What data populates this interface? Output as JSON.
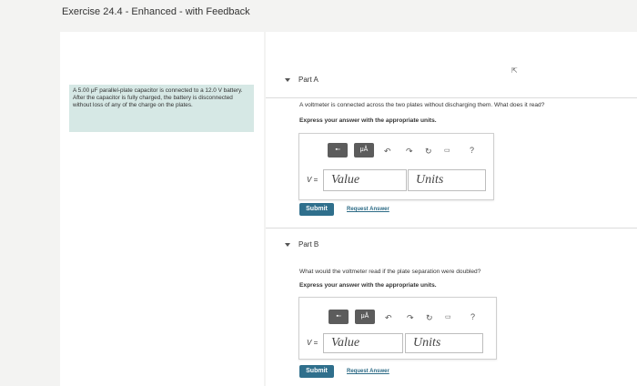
{
  "page": {
    "title": "Exercise 24.4 - Enhanced - with Feedback"
  },
  "problem": {
    "text": "A 5.00 μF parallel-plate capacitor is connected to a 12.0 V battery. After the capacitor is fully charged, the battery is disconnected without loss of any of the charge on the plates."
  },
  "toolbar_icons": [
    "template-icon",
    "units-mu-icon",
    "undo-icon",
    "redo-icon",
    "reset-icon",
    "keyboard-icon",
    "help-icon"
  ],
  "parts": [
    {
      "label": "Part A",
      "question": "A voltmeter is connected across the two plates without discharging them. What does it read?",
      "instruction": "Express your answer with the appropriate units.",
      "variable": "V =",
      "value_placeholder": "Value",
      "units_placeholder": "Units",
      "submit_label": "Submit",
      "request_label": "Request Answer",
      "mu_label": "μÅ",
      "help_label": "?"
    },
    {
      "label": "Part B",
      "question": "What would the voltmeter read if the plate separation were doubled?",
      "instruction": "Express your answer with the appropriate units.",
      "variable": "V =",
      "value_placeholder": "Value",
      "units_placeholder": "Units",
      "submit_label": "Submit",
      "request_label": "Request Answer",
      "mu_label": "μÅ",
      "help_label": "?"
    }
  ],
  "colors": {
    "problem_bg": "#d6e8e5",
    "submit_bg": "#2f6f8c",
    "link": "#2d6b86",
    "toolbar_btn": "#5c5c5c"
  }
}
